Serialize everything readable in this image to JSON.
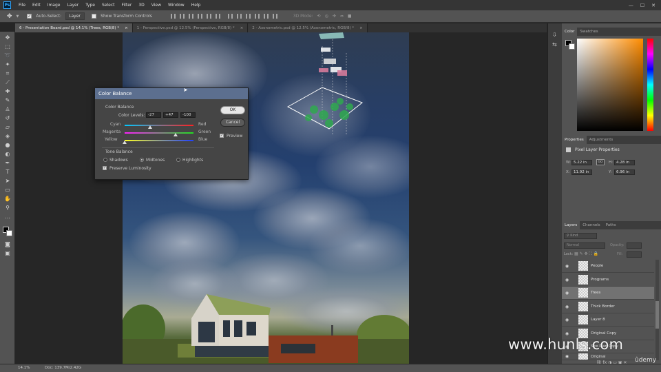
{
  "menubar": {
    "app_logo": "Ps",
    "items": [
      "File",
      "Edit",
      "Image",
      "Layer",
      "Type",
      "Select",
      "Filter",
      "3D",
      "View",
      "Window",
      "Help"
    ],
    "window_controls": [
      "—",
      "☐",
      "✕"
    ]
  },
  "optionsbar": {
    "auto_select_label": "Auto-Select:",
    "auto_select_value": "Layer",
    "show_transform_label": "Show Transform Controls",
    "mode_3d_label": "3D Mode:"
  },
  "tabs": [
    {
      "label": "6 - Presentation Board.psd @ 14.1% (Trees, RGB/8) *",
      "close": "×"
    },
    {
      "label": "1 - Perspective.psd @ 12.5% (Perspective, RGB/8) *",
      "close": "×"
    },
    {
      "label": "2 - Axonometric.psd @ 12.5% (Axonometric, RGB/8) *",
      "close": "×"
    }
  ],
  "color_balance": {
    "title": "Color Balance",
    "section_color_balance": "Color Balance",
    "color_levels_label": "Color Levels:",
    "levels": [
      "-27",
      "+47",
      "-100"
    ],
    "sliders": [
      {
        "left": "Cyan",
        "right": "Red",
        "value": -27
      },
      {
        "left": "Magenta",
        "right": "Green",
        "value": 47
      },
      {
        "left": "Yellow",
        "right": "Blue",
        "value": -100
      }
    ],
    "section_tone": "Tone Balance",
    "tones": [
      "Shadows",
      "Midtones",
      "Highlights"
    ],
    "selected_tone": "Midtones",
    "preserve_luminosity": "Preserve Luminosity",
    "ok": "OK",
    "cancel": "Cancel",
    "preview": "Preview"
  },
  "color_panel": {
    "tabs": [
      "Color",
      "Swatches"
    ],
    "hue_color": "#ff8c00"
  },
  "properties_panel": {
    "tabs": [
      "Properties",
      "Adjustments"
    ],
    "title": "Pixel Layer Properties",
    "w_label": "W:",
    "w_value": "5.22 in",
    "h_label": "H:",
    "h_value": "4.28 in",
    "x_label": "X:",
    "x_value": "11.92 in",
    "y_label": "Y:",
    "y_value": "6.96 in",
    "link_icon": "GO"
  },
  "layers_panel": {
    "tabs": [
      "Layers",
      "Channels",
      "Paths"
    ],
    "kind_label": "Kind",
    "blend_mode": "Normal",
    "opacity_label": "Opacity:",
    "lock_label": "Lock:",
    "fill_label": "Fill:",
    "layers": [
      {
        "name": "People",
        "selected": false
      },
      {
        "name": "Programs",
        "selected": false
      },
      {
        "name": "Trees",
        "selected": true
      },
      {
        "name": "Thick Border",
        "selected": false
      },
      {
        "name": "Layer 8",
        "selected": false
      },
      {
        "name": "Original Copy",
        "selected": false
      },
      {
        "name": "Site Plan Copy",
        "selected": false
      },
      {
        "name": "Original",
        "selected": false
      }
    ]
  },
  "statusbar": {
    "zoom": "14.1%",
    "doc": "Doc: 139.7M/2.42G"
  },
  "watermark": "www.hunls.com",
  "udemy": "ûdemy"
}
